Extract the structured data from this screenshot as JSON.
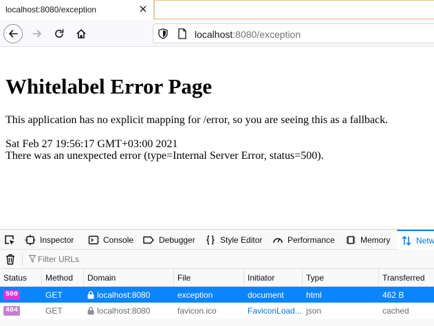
{
  "tab": {
    "title": "localhost:8080/exception"
  },
  "urlbar": {
    "host": "localhost",
    "rest": ":8080/exception"
  },
  "page": {
    "heading": "Whitelabel Error Page",
    "message": "This application has no explicit mapping for /error, so you are seeing this as a fallback.",
    "timestamp": "Sat Feb 27 19:56:17 GMT+03:00 2021",
    "error": "There was an unexpected error (type=Internal Server Error, status=500)."
  },
  "devtools": {
    "tabs": [
      "Inspector",
      "Console",
      "Debugger",
      "Style Editor",
      "Performance",
      "Memory",
      "Netw"
    ],
    "filter_placeholder": "Filter URLs"
  },
  "network": {
    "columns": [
      "Status",
      "Method",
      "Domain",
      "File",
      "Initiator",
      "Type",
      "Transferred"
    ],
    "rows": [
      {
        "status": "500",
        "method": "GET",
        "domain": "localhost:8080",
        "file": "exception",
        "initiator": "document",
        "type": "html",
        "transferred": "462 B"
      },
      {
        "status": "404",
        "method": "GET",
        "domain": "localhost:8080",
        "file": "favicon.ico",
        "initiator": "FaviconLoad...",
        "type": "json",
        "transferred": "cached"
      }
    ]
  }
}
